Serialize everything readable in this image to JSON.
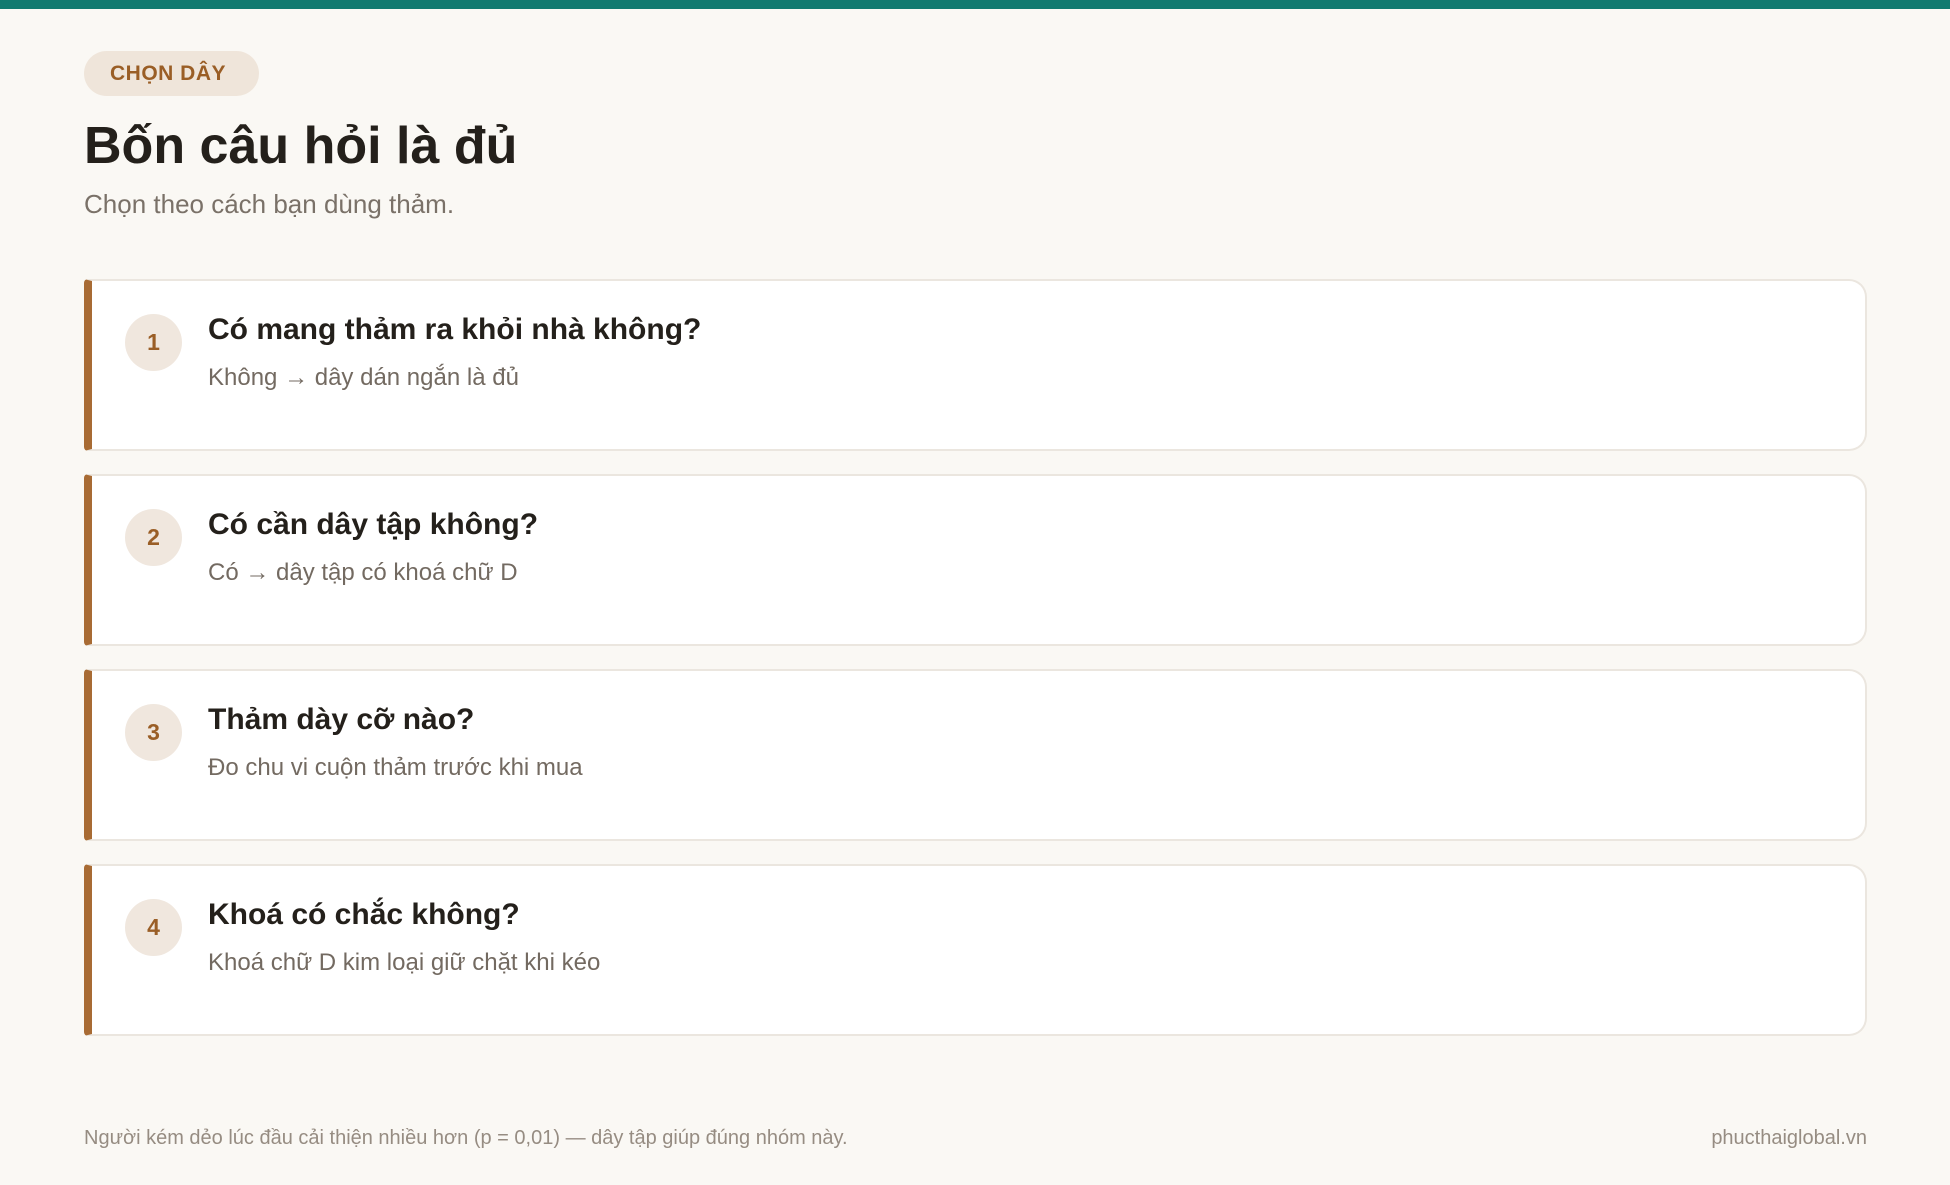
{
  "colors": {
    "accent_top_bar": "#127a70",
    "card_accent": "#a86b34",
    "badge_bg": "#efe5da",
    "badge_text": "#9a5e26",
    "background": "#faf8f4"
  },
  "header": {
    "eyebrow": "CHỌN DÂY",
    "title": "Bốn câu hỏi là đủ",
    "subtitle": "Chọn theo cách bạn dùng thảm."
  },
  "questions": [
    {
      "number": "1",
      "title": "Có mang thảm ra khỏi nhà không?",
      "answer": "Không → dây dán ngắn là đủ"
    },
    {
      "number": "2",
      "title": "Có cần dây tập không?",
      "answer": "Có → dây tập có khoá chữ D"
    },
    {
      "number": "3",
      "title": "Thảm dày cỡ nào?",
      "answer": "Đo chu vi cuộn thảm trước khi mua"
    },
    {
      "number": "4",
      "title": "Khoá có chắc không?",
      "answer": "Khoá chữ D kim loại giữ chặt khi kéo"
    }
  ],
  "footer": {
    "note": "Người kém dẻo lúc đầu cải thiện nhiều hơn (p = 0,01) — dây tập giúp đúng nhóm này.",
    "site": "phucthaiglobal.vn"
  }
}
